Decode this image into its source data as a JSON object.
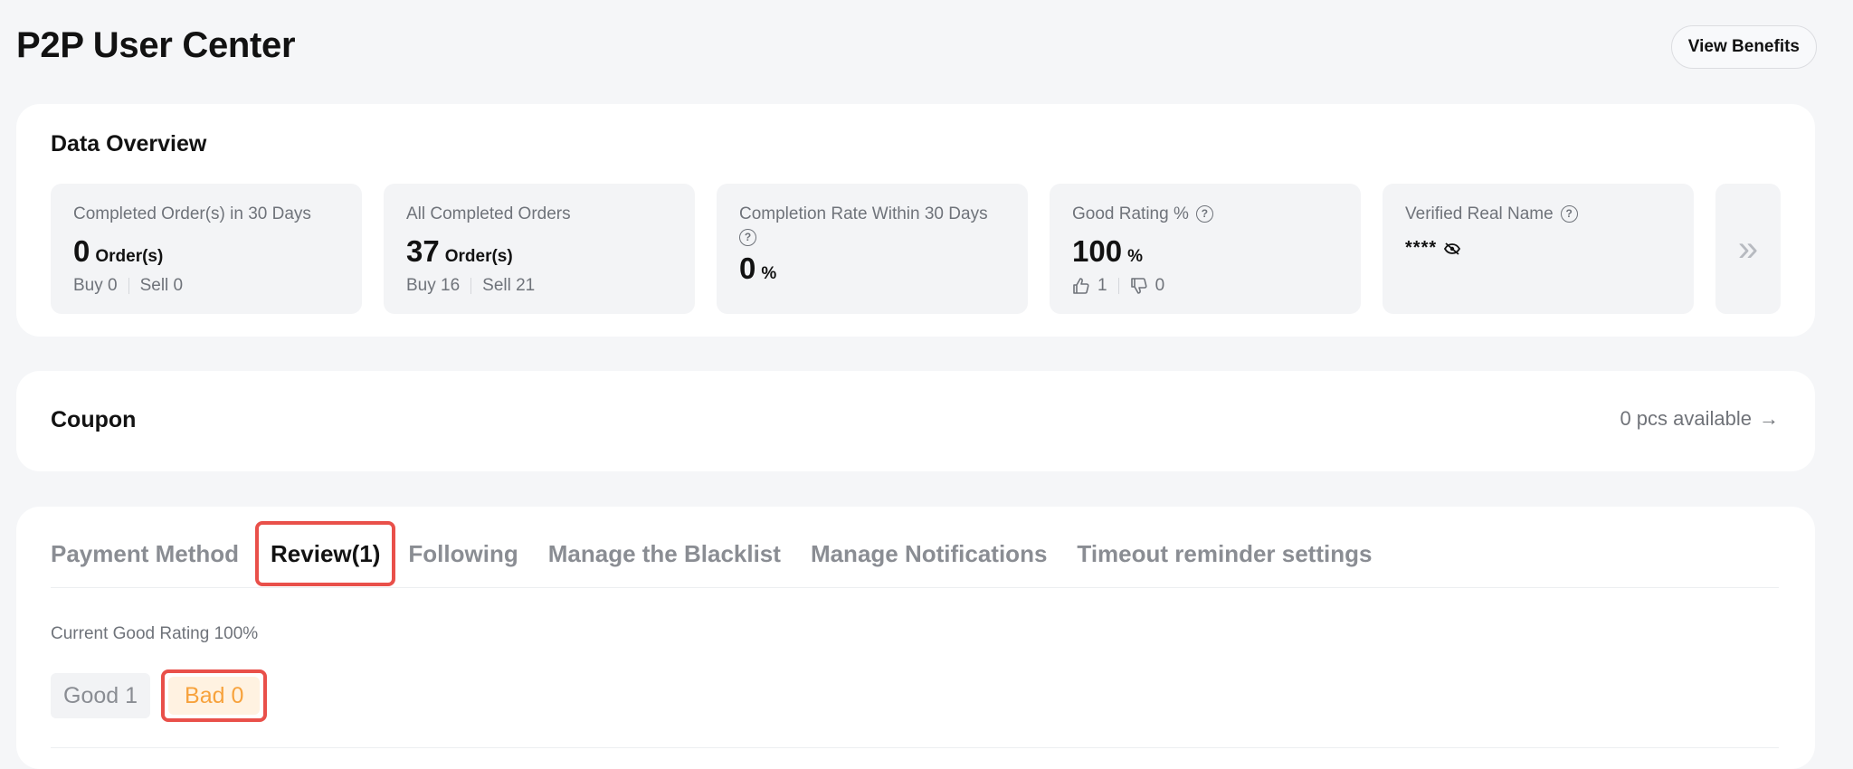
{
  "header": {
    "title": "P2P User Center",
    "view_benefits": "View Benefits"
  },
  "overview": {
    "title": "Data Overview",
    "stats": [
      {
        "label": "Completed Order(s) in 30 Days",
        "value": "0",
        "unit": "Order(s)",
        "sub_a": "Buy 0",
        "sub_b": "Sell 0"
      },
      {
        "label": "All Completed Orders",
        "value": "37",
        "unit": "Order(s)",
        "sub_a": "Buy 16",
        "sub_b": "Sell 21"
      },
      {
        "label": "Completion Rate Within 30 Days",
        "value": "0",
        "unit": "%"
      },
      {
        "label": "Good Rating %",
        "value": "100",
        "unit": "%",
        "thumbs_up": "1",
        "thumbs_down": "0"
      },
      {
        "label": "Verified Real Name",
        "value": "****"
      }
    ],
    "next_icon": "double-chevron-right-icon"
  },
  "coupon": {
    "title": "Coupon",
    "available": "0 pcs available",
    "arrow": "→"
  },
  "tabs": {
    "items": [
      "Payment Method",
      "Review(1)",
      "Following",
      "Manage the Blacklist",
      "Manage Notifications",
      "Timeout reminder settings"
    ],
    "active_index": 1
  },
  "review": {
    "current_rating": "Current Good Rating 100%",
    "good_label": "Good 1",
    "bad_label": "Bad 0"
  },
  "colors": {
    "highlight": "#e9504a",
    "bad_text": "#f7a23c",
    "bad_bg": "#fff2e1"
  }
}
